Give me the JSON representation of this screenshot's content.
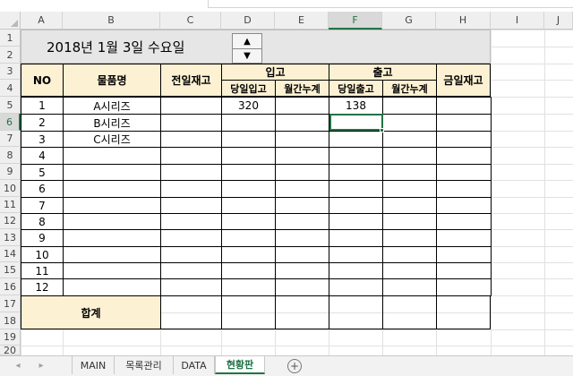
{
  "columns": [
    "A",
    "B",
    "C",
    "D",
    "E",
    "F",
    "G",
    "H",
    "I",
    "J"
  ],
  "rows": [
    "1",
    "2",
    "3",
    "4",
    "5",
    "6",
    "7",
    "8",
    "9",
    "10",
    "11",
    "12",
    "13",
    "14",
    "15",
    "16",
    "17",
    "18",
    "19",
    "20"
  ],
  "title": "2018년 1월 3일 수요일",
  "spinner": {
    "up": "▲",
    "down": "▼"
  },
  "headers": {
    "no": "NO",
    "item": "물품명",
    "prev_stock": "전일재고",
    "incoming": "입고",
    "outgoing": "출고",
    "today_stock": "금일재고",
    "in_today": "당일입고",
    "in_month": "월간누계",
    "out_today": "당일출고",
    "out_month": "월간누계"
  },
  "table_rows": [
    {
      "no": "1",
      "item": "A시리즈",
      "in_today": "320",
      "out_today": "138"
    },
    {
      "no": "2",
      "item": "B시리즈",
      "in_today": "",
      "out_today": ""
    },
    {
      "no": "3",
      "item": "C시리즈",
      "in_today": "",
      "out_today": ""
    },
    {
      "no": "4",
      "item": "",
      "in_today": "",
      "out_today": ""
    },
    {
      "no": "5",
      "item": "",
      "in_today": "",
      "out_today": ""
    },
    {
      "no": "6",
      "item": "",
      "in_today": "",
      "out_today": ""
    },
    {
      "no": "7",
      "item": "",
      "in_today": "",
      "out_today": ""
    },
    {
      "no": "8",
      "item": "",
      "in_today": "",
      "out_today": ""
    },
    {
      "no": "9",
      "item": "",
      "in_today": "",
      "out_today": ""
    },
    {
      "no": "10",
      "item": "",
      "in_today": "",
      "out_today": ""
    },
    {
      "no": "11",
      "item": "",
      "in_today": "",
      "out_today": ""
    },
    {
      "no": "12",
      "item": "",
      "in_today": "",
      "out_today": ""
    }
  ],
  "total_label": "합계",
  "tabs": [
    "MAIN",
    "목록관리",
    "DATA",
    "현황판"
  ],
  "active_tab": "현황판",
  "add_sheet_icon": "+",
  "nav_prev": "◂",
  "nav_next": "▸",
  "colors": {
    "accent": "#217346",
    "header_fill": "#fdf1d3",
    "title_fill": "#e6e6e6"
  }
}
